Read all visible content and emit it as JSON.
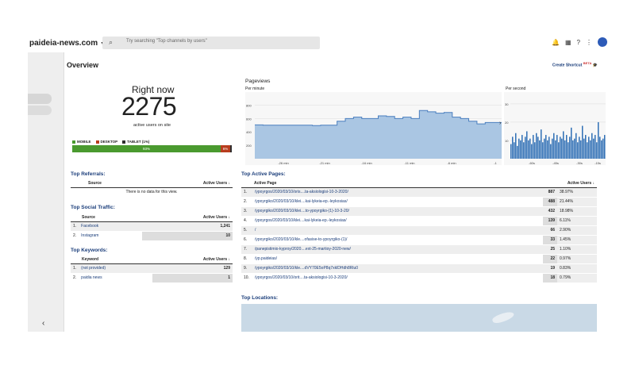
{
  "topbar": {
    "site": "paideia-news.com",
    "search_placeholder": "Try searching \"Top channels by users\""
  },
  "overview": {
    "title": "Overview",
    "shortcut": "Create Shortcut",
    "shortcut_badge": "BETA"
  },
  "realtime": {
    "label": "Right now",
    "count": "2275",
    "sub": "active users on site",
    "legend": [
      {
        "label": "MOBILE",
        "color": "#4a9a2f"
      },
      {
        "label": "DESKTOP",
        "color": "#b83d1e"
      },
      {
        "label": "TABLET (1%)",
        "color": "#2f2f2f"
      }
    ],
    "mobile_pct_label": "93%",
    "desktop_pct_label": "6%",
    "mobile_share": 0.93,
    "desktop_share": 0.06,
    "tablet_share": 0.01
  },
  "pageviews": {
    "title": "Pageviews",
    "per_minute": "Per minute",
    "per_second": "Per second",
    "y_ticks": [
      "800",
      "600",
      "400",
      "200"
    ],
    "x_ticks": [
      "-26 min",
      "-21 min",
      "-16 min",
      "-11 min",
      "-6 min",
      "-1"
    ],
    "sec_y_ticks": [
      "30",
      "20",
      "10"
    ],
    "sec_x_ticks": [
      "-60s",
      "-45s",
      "-30s",
      "-15s"
    ],
    "minute_values": [
      505,
      500,
      500,
      500,
      500,
      500,
      500,
      495,
      500,
      500,
      560,
      600,
      620,
      600,
      600,
      640,
      630,
      600,
      620,
      600,
      720,
      700,
      680,
      690,
      620,
      600,
      560,
      520,
      540,
      540
    ],
    "second_values": [
      8,
      12,
      9,
      14,
      7,
      11,
      10,
      13,
      9,
      12,
      15,
      10,
      11,
      8,
      13,
      9,
      14,
      12,
      10,
      16,
      9,
      11,
      13,
      10,
      12,
      8,
      11,
      14,
      10,
      13,
      9,
      12,
      11,
      15,
      10,
      13,
      9,
      12,
      17,
      10,
      11,
      14,
      9,
      12,
      10,
      18,
      11,
      13,
      9,
      12,
      10,
      14,
      11,
      13,
      9,
      20,
      12,
      10,
      11,
      13
    ]
  },
  "referrals": {
    "title": "Top Referrals:",
    "col1": "Source",
    "col2": "Active Users",
    "empty": "There is no data for this view."
  },
  "social": {
    "title": "Top Social Traffic:",
    "col1": "Source",
    "col2": "Active Users",
    "rows": [
      {
        "n": "1.",
        "source": "Facebook",
        "users": "1,241"
      },
      {
        "n": "2.",
        "source": "Instagram",
        "users": "10"
      }
    ]
  },
  "keywords": {
    "title": "Top Keywords:",
    "col1": "Keyword",
    "col2": "Active Users",
    "rows": [
      {
        "n": "1.",
        "source": "(not provided)",
        "users": "129"
      },
      {
        "n": "2.",
        "source": "paidia news",
        "users": "1"
      }
    ]
  },
  "pages": {
    "title": "Top Active Pages:",
    "col1": "Active Page",
    "col2": "Active Users",
    "rows": [
      {
        "n": "1.",
        "page": "/ypoyrgos/2020/03/10/oris....ta-aksiologisi-10-3-2020/",
        "users": "887",
        "pct": "38.97%"
      },
      {
        "n": "2.",
        "page": "/ypoyrgiko/2020/03/10/klei....kai-lykeia-ep.-leykosias/",
        "users": "488",
        "pct": "21.44%"
      },
      {
        "n": "3.",
        "page": "/ypoyrgiko/2020/03/10/klei....to-ypoyrgiko-(1)-10-3-20/",
        "users": "432",
        "pct": "18.98%"
      },
      {
        "n": "4.",
        "page": "/ypoyrgos/2020/03/10/klei....kai-lykeia-ep.-leykosias/",
        "users": "139",
        "pct": "6.11%"
      },
      {
        "n": "5.",
        "page": "/",
        "users": "66",
        "pct": "2.90%"
      },
      {
        "n": "6.",
        "page": "/ypoyrgiko/2020/03/10/kle....ofasise-to-ypoyrgiko-(1)/",
        "users": "33",
        "pct": "1.45%"
      },
      {
        "n": "7.",
        "page": "/panepistimio-kyproy/2020....ext-25-martioy-2020-new/",
        "users": "25",
        "pct": "1.10%"
      },
      {
        "n": "8.",
        "page": "/yp.paideias/",
        "users": "22",
        "pct": "0.97%"
      },
      {
        "n": "9.",
        "page": "/ypoyrgiko/2020/03/10/kle....dVY70E5oP8q7xklDHdh8Rlu0",
        "users": "19",
        "pct": "0.83%"
      },
      {
        "n": "10.",
        "page": "/ypoyrgos/2020/03/10/orit....ta-aksiologisi-10-3-2020/",
        "users": "18",
        "pct": "0.79%"
      }
    ]
  },
  "locations": {
    "title": "Top Locations:"
  }
}
